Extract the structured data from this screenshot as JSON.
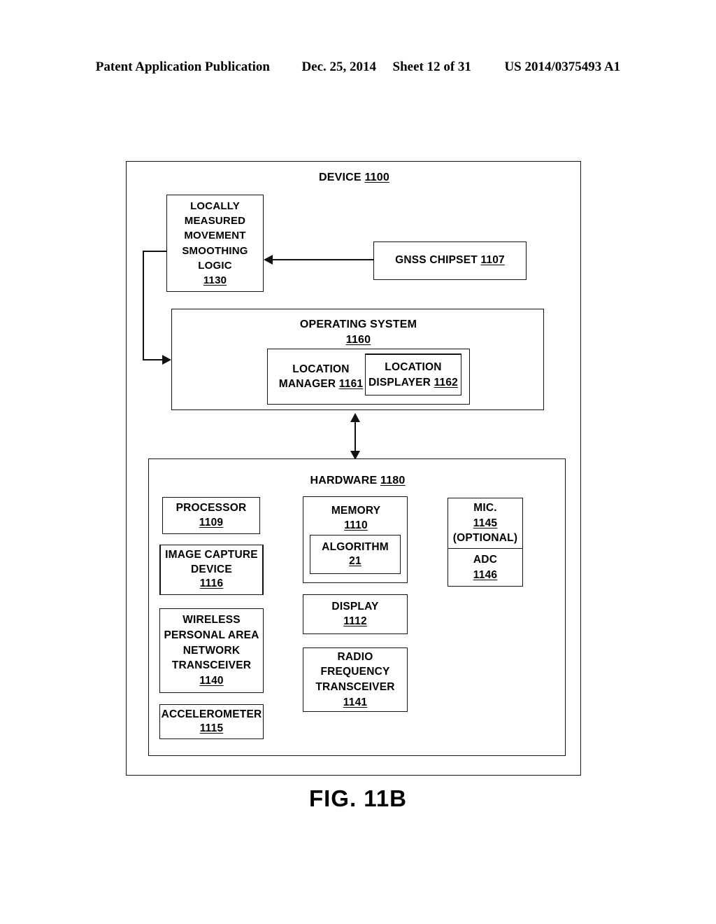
{
  "page_header": {
    "publication": "Patent Application Publication",
    "date": "Dec. 25, 2014",
    "sheet": "Sheet 12 of 31",
    "publication_number": "US 2014/0375493 A1"
  },
  "figure": {
    "caption": "FIG. 11B"
  },
  "diagram": {
    "device": {
      "title": "DEVICE",
      "ref": "1100"
    },
    "smoothing_logic": {
      "line1": "LOCALLY",
      "line2": "MEASURED",
      "line3": "MOVEMENT",
      "line4": "SMOOTHING",
      "line5": "LOGIC",
      "ref": "1130"
    },
    "gnss_chipset": {
      "label": "GNSS CHIPSET",
      "ref": "1107"
    },
    "operating_system": {
      "title": "OPERATING SYSTEM",
      "ref": "1160"
    },
    "location_manager": {
      "line1": "LOCATION",
      "line2": "MANAGER",
      "ref": "1161"
    },
    "location_displayer": {
      "line1": "LOCATION",
      "line2": "DISPLAYER",
      "ref": "1162"
    },
    "hardware": {
      "title": "HARDWARE",
      "ref": "1180"
    },
    "processor": {
      "label": "PROCESSOR",
      "ref": "1109"
    },
    "image_capture_device": {
      "line1": "IMAGE CAPTURE",
      "line2": "DEVICE",
      "ref": "1116"
    },
    "wpan_transceiver": {
      "line1": "WIRELESS",
      "line2": "PERSONAL AREA",
      "line3": "NETWORK",
      "line4": "TRANSCEIVER",
      "ref": "1140"
    },
    "accelerometer": {
      "label": "ACCELEROMETER",
      "ref": "1115"
    },
    "memory": {
      "label": "MEMORY",
      "ref": "1110"
    },
    "algorithm": {
      "label": "ALGORITHM",
      "ref": "21"
    },
    "display": {
      "label": "DISPLAY",
      "ref": "1112"
    },
    "radio_frequency_transceiver": {
      "line1": "RADIO",
      "line2": "FREQUENCY",
      "line3": "TRANSCEIVER",
      "ref": "1141"
    },
    "microphone": {
      "label": "MIC.",
      "ref": "1145",
      "optional": "(OPTIONAL)"
    },
    "adc": {
      "label": "ADC",
      "ref": "1146"
    }
  }
}
